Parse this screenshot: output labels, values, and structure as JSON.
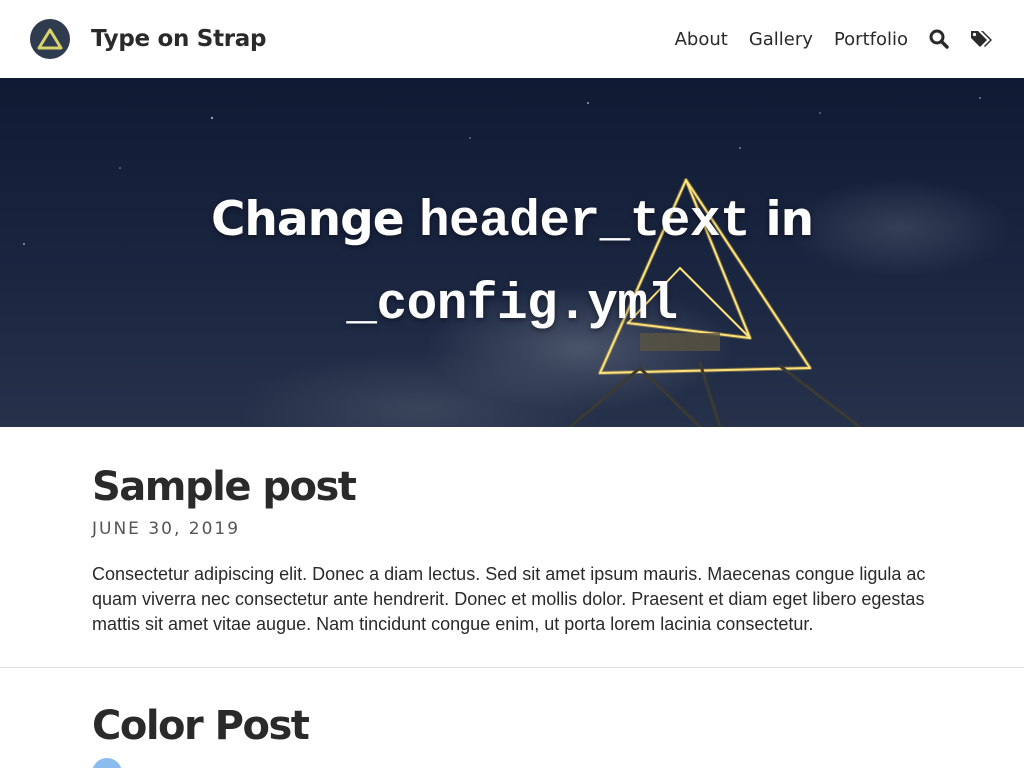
{
  "site": {
    "title": "Type on Strap",
    "logo_icon": "triangle-logo-icon"
  },
  "nav": {
    "links": [
      "About",
      "Gallery",
      "Portfolio"
    ],
    "search_icon": "search-icon",
    "tags_icon": "tags-icon"
  },
  "hero": {
    "title_part1": "Change ",
    "title_code1": "header_text",
    "title_part2": " in",
    "title_code2": "_config.yml"
  },
  "posts": [
    {
      "title": "Sample post",
      "date": "JUNE 30, 2019",
      "excerpt": "Consectetur adipiscing elit. Donec a diam lectus. Sed sit amet ipsum mauris. Maecenas congue ligula ac quam viverra nec consectetur ante hendrerit. Donec et mollis dolor. Praesent et diam eget libero egestas mattis sit amet vitae augue. Nam tincidunt congue enim, ut porta lorem lacinia consectetur."
    },
    {
      "title": "Color Post"
    }
  ],
  "colors": {
    "nav_bg": "#ffffff",
    "text": "#2a2a2a",
    "logo_bg": "#2f3b4f",
    "logo_accent": "#d8d36a",
    "hero_light": "#f2c84b",
    "color_post_dot": "#8bbcf0"
  }
}
